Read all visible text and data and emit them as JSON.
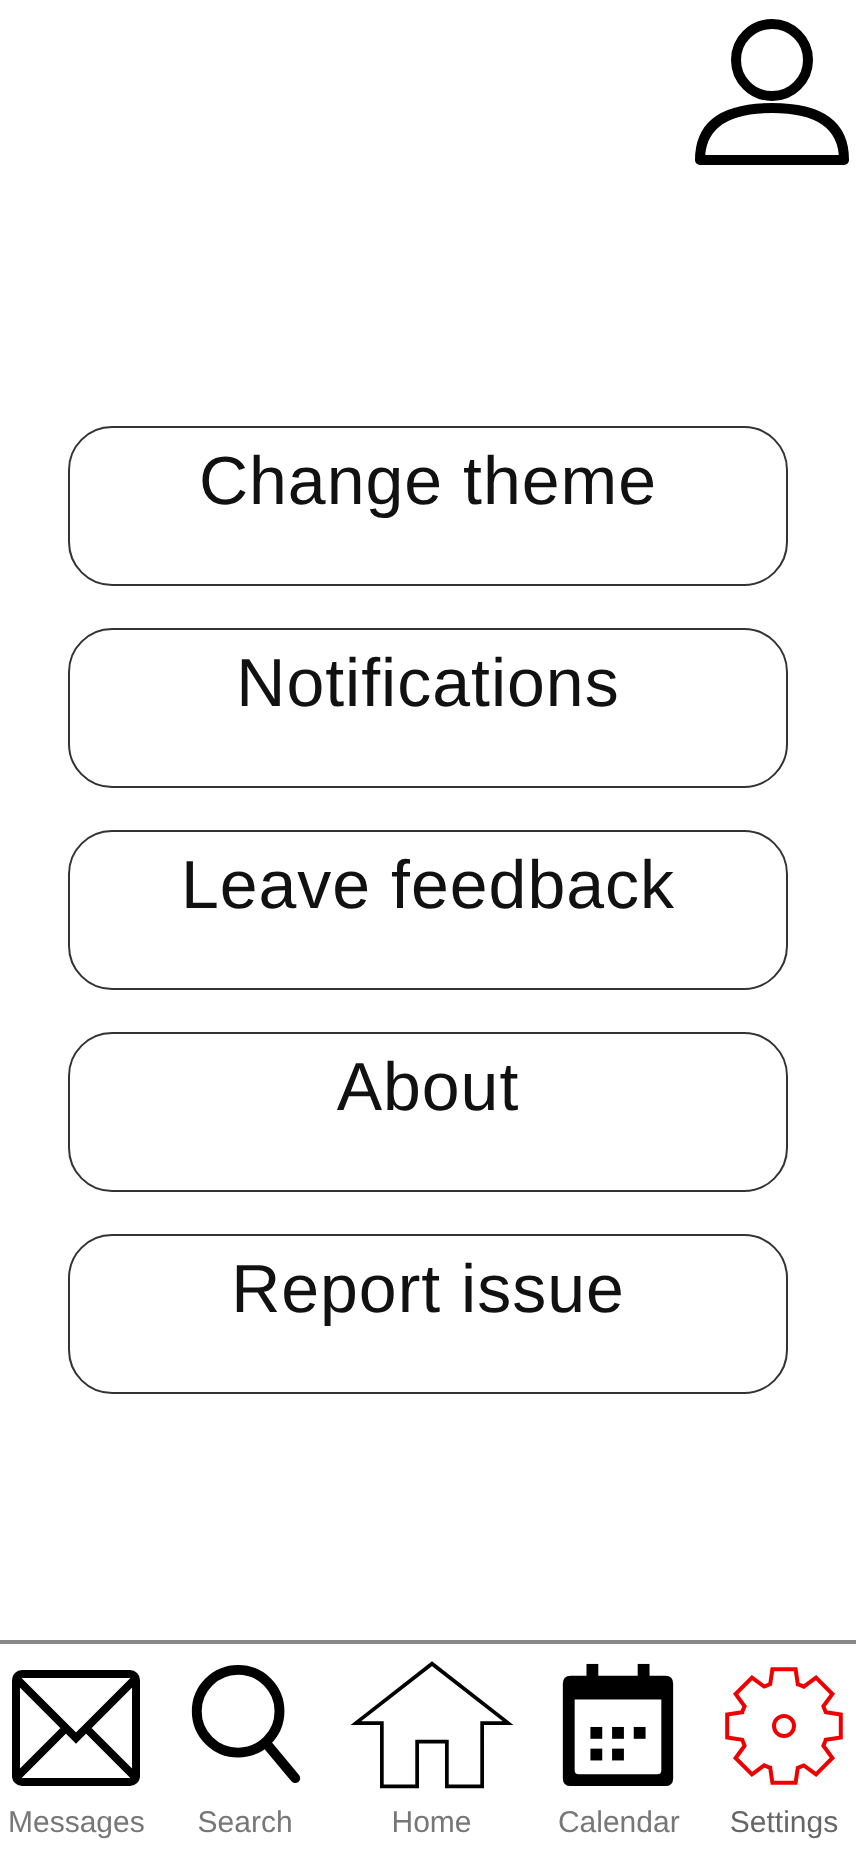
{
  "menu": [
    {
      "label": "Change theme"
    },
    {
      "label": "Notifications"
    },
    {
      "label": "Leave feedback"
    },
    {
      "label": "About"
    },
    {
      "label": "Report issue"
    }
  ],
  "nav": [
    {
      "kind": "messages",
      "label": "Messages",
      "selected": false
    },
    {
      "kind": "search",
      "label": "Search",
      "selected": false
    },
    {
      "kind": "home",
      "label": "Home",
      "selected": false
    },
    {
      "kind": "calendar",
      "label": "Calendar",
      "selected": false
    },
    {
      "kind": "settings",
      "label": "Settings",
      "selected": true
    }
  ]
}
